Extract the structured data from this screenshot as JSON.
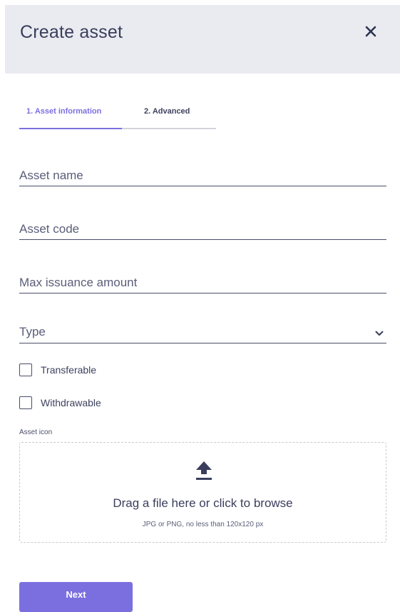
{
  "header": {
    "title": "Create asset",
    "close_icon": "close-icon"
  },
  "tabs": [
    {
      "label": "1. Asset information",
      "active": true
    },
    {
      "label": "2. Advanced",
      "active": false
    }
  ],
  "form": {
    "asset_name_placeholder": "Asset name",
    "asset_name_value": "",
    "asset_code_placeholder": "Asset code",
    "asset_code_value": "",
    "max_issuance_placeholder": "Max issuance amount",
    "max_issuance_value": "",
    "type_label": "Type",
    "transferable_label": "Transferable",
    "transferable_checked": false,
    "withdrawable_label": "Withdrawable",
    "withdrawable_checked": false,
    "asset_icon_label": "Asset icon"
  },
  "dropzone": {
    "icon": "upload-icon",
    "title": "Drag a file here or click to browse",
    "hint": "JPG or PNG, no less than 120x120 px"
  },
  "actions": {
    "next_label": "Next"
  },
  "colors": {
    "accent": "#7b6fe0",
    "header_bg": "#e9ebf0",
    "text": "#3e425e"
  }
}
